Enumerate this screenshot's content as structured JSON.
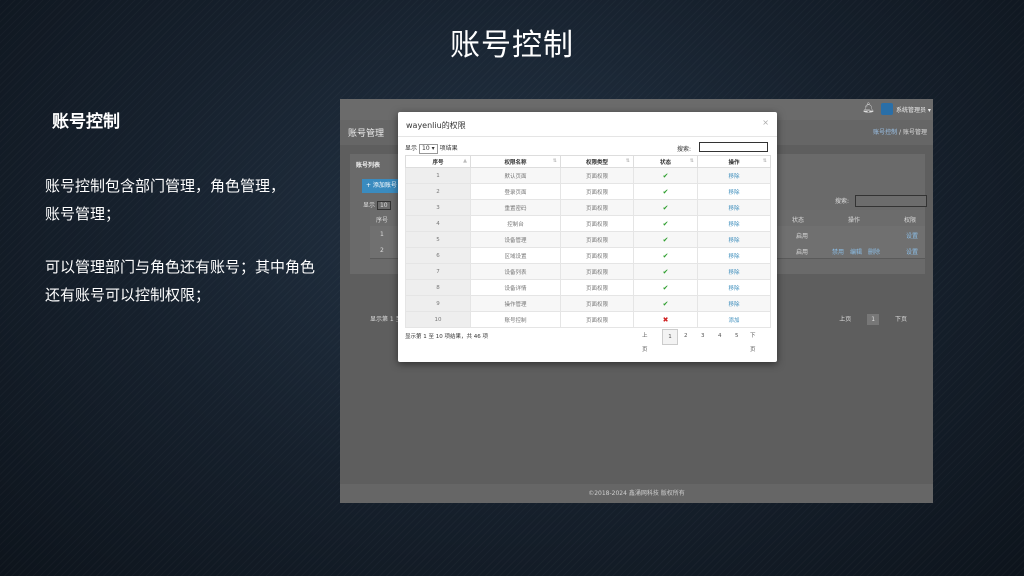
{
  "slide": {
    "title": "账号控制",
    "heading": "账号控制",
    "para1": "账号控制包含部门管理，角色管理，账号管理；",
    "para2": "可以管理部门与角色还有账号；其中角色还有账号可以控制权限；"
  },
  "app": {
    "admin_label": "系统管理员",
    "page_title": "账号管理",
    "breadcrumb": [
      "账号控制",
      "账号管理"
    ],
    "panel_title": "账号列表",
    "add_label": "+ 添加账号",
    "show_prefix": "显示",
    "show_value": "10",
    "search_label": "搜索:",
    "columns": [
      "序号",
      "状态",
      "操作",
      "权限"
    ],
    "rows": [
      {
        "idx": "1",
        "status": "启用",
        "actions": [],
        "perm": "设置"
      },
      {
        "idx": "2",
        "status": "启用",
        "actions": [
          "禁用",
          "编辑",
          "删除"
        ],
        "perm": "设置"
      }
    ],
    "footer": "显示第 1 至 2",
    "pager": {
      "prev": "上页",
      "page": "1",
      "next": "下页"
    },
    "copyright": "©2018-2024 鑫涌网科技 版权所有"
  },
  "modal": {
    "title": "wayenliu的权限",
    "close": "×",
    "length_prefix": "显示",
    "length_value": "10",
    "length_suffix": "项结果",
    "search_label": "搜索:",
    "search_value": "",
    "columns": [
      "序号",
      "权限名称",
      "权限类型",
      "状态",
      "操作"
    ],
    "rows": [
      {
        "idx": "1",
        "name": "默认页面",
        "type": "页面权限",
        "status": "ok",
        "action": "移除"
      },
      {
        "idx": "2",
        "name": "登录页面",
        "type": "页面权限",
        "status": "ok",
        "action": "移除"
      },
      {
        "idx": "3",
        "name": "重置密码",
        "type": "页面权限",
        "status": "ok",
        "action": "移除"
      },
      {
        "idx": "4",
        "name": "控制台",
        "type": "页面权限",
        "status": "ok",
        "action": "移除"
      },
      {
        "idx": "5",
        "name": "设备管理",
        "type": "页面权限",
        "status": "ok",
        "action": "移除"
      },
      {
        "idx": "6",
        "name": "区域设置",
        "type": "页面权限",
        "status": "ok",
        "action": "移除"
      },
      {
        "idx": "7",
        "name": "设备列表",
        "type": "页面权限",
        "status": "ok",
        "action": "移除"
      },
      {
        "idx": "8",
        "name": "设备详情",
        "type": "页面权限",
        "status": "ok",
        "action": "移除"
      },
      {
        "idx": "9",
        "name": "操作管理",
        "type": "页面权限",
        "status": "ok",
        "action": "移除"
      },
      {
        "idx": "10",
        "name": "账号控制",
        "type": "页面权限",
        "status": "no",
        "action": "添加"
      }
    ],
    "info": "显示第 1 至 10 项结果，共 46 项",
    "pager": {
      "prev": "上页",
      "pages": [
        "1",
        "2",
        "3",
        "4",
        "5"
      ],
      "next": "下页"
    },
    "status_icons": {
      "ok": "✔",
      "no": "✖"
    }
  }
}
